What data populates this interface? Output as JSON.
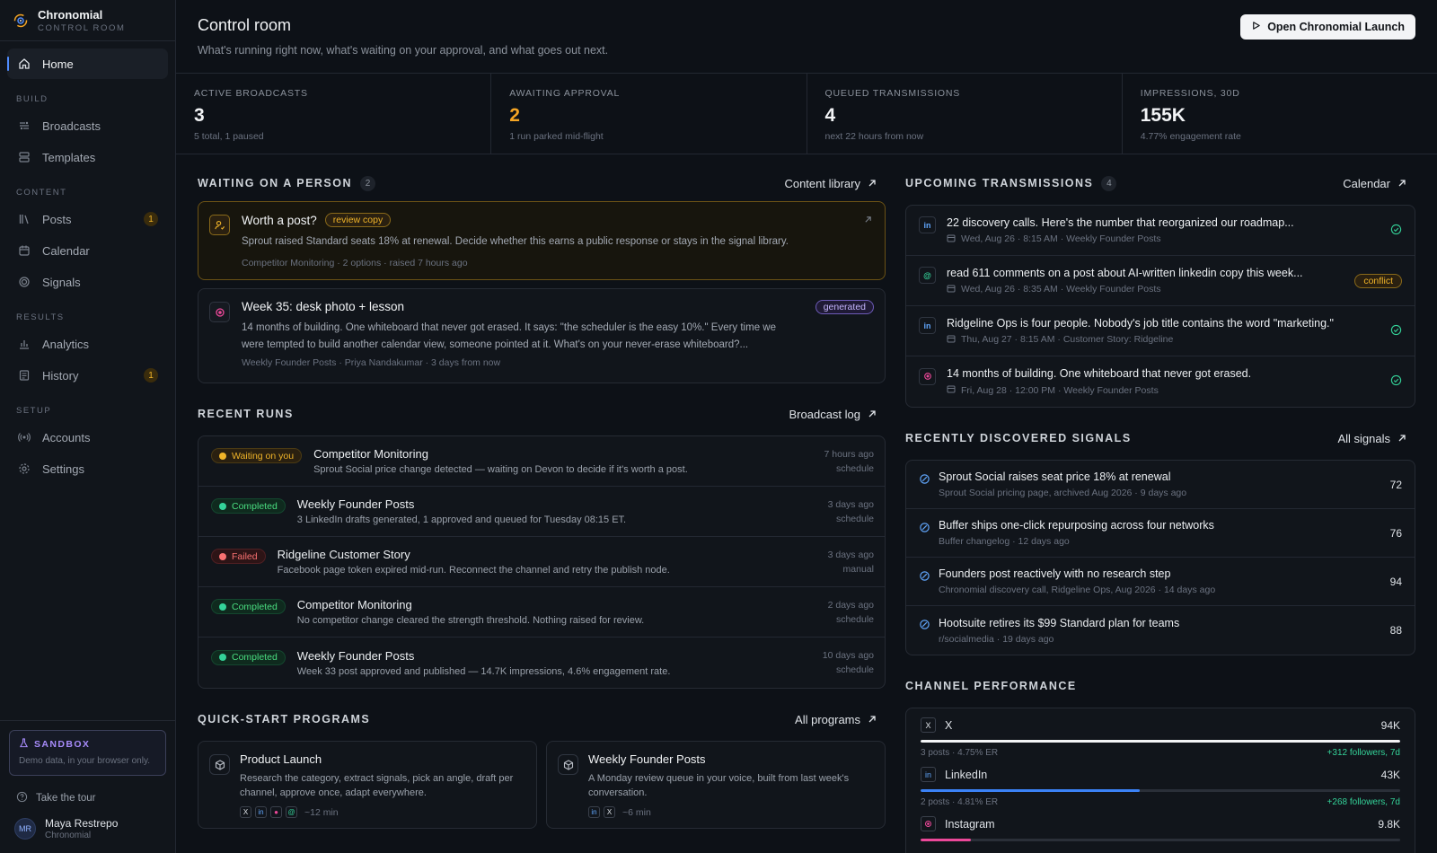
{
  "brand": {
    "name": "Chronomial",
    "sub": "CONTROL ROOM"
  },
  "nav": {
    "home": "Home",
    "sections": {
      "build": "BUILD",
      "content": "CONTENT",
      "results": "RESULTS",
      "setup": "SETUP"
    },
    "broadcasts": "Broadcasts",
    "templates": "Templates",
    "posts": "Posts",
    "posts_badge": "1",
    "calendar": "Calendar",
    "signals": "Signals",
    "analytics": "Analytics",
    "history": "History",
    "history_badge": "1",
    "accounts": "Accounts",
    "settings": "Settings"
  },
  "sandbox": {
    "title": "SANDBOX",
    "text": "Demo data, in your browser only."
  },
  "tour": "Take the tour",
  "user": {
    "initials": "MR",
    "name": "Maya Restrepo",
    "org": "Chronomial"
  },
  "header": {
    "title": "Control room",
    "subtitle": "What's running right now, what's waiting on your approval, and what goes out next.",
    "launch_button": "Open Chronomial Launch"
  },
  "stats": [
    {
      "label": "ACTIVE BROADCASTS",
      "value": "3",
      "note": "5 total, 1 paused"
    },
    {
      "label": "AWAITING APPROVAL",
      "value": "2",
      "note": "1 run parked mid-flight"
    },
    {
      "label": "QUEUED TRANSMISSIONS",
      "value": "4",
      "note": "next 22 hours from now"
    },
    {
      "label": "IMPRESSIONS, 30D",
      "value": "155K",
      "note": "4.77% engagement rate"
    }
  ],
  "waiting": {
    "title": "WAITING ON A PERSON",
    "count": "2",
    "link": "Content library",
    "items": [
      {
        "title": "Worth a post?",
        "tag": "review copy",
        "body": "Sprout raised Standard seats 18% at renewal. Decide whether this earns a public response or stays in the signal library.",
        "meta": "Competitor Monitoring · 2 options · raised 7 hours ago"
      },
      {
        "title": "Week 35: desk photo + lesson",
        "tag": "generated",
        "body": "14 months of building. One whiteboard that never got erased. It says: \"the scheduler is the easy 10%.\" Every time we were tempted to build another calendar view, someone pointed at it. What's on your never-erase whiteboard?...",
        "meta": "Weekly Founder Posts · Priya Nandakumar · 3 days from now"
      }
    ]
  },
  "runs": {
    "title": "RECENT RUNS",
    "link": "Broadcast log",
    "items": [
      {
        "status": "Waiting on you",
        "title": "Competitor Monitoring",
        "sub": "Sprout Social price change detected — waiting on Devon to decide if it's worth a post.",
        "time": "7 hours ago",
        "trigger": "schedule"
      },
      {
        "status": "Completed",
        "title": "Weekly Founder Posts",
        "sub": "3 LinkedIn drafts generated, 1 approved and queued for Tuesday 08:15 ET.",
        "time": "3 days ago",
        "trigger": "schedule"
      },
      {
        "status": "Failed",
        "title": "Ridgeline Customer Story",
        "sub": "Facebook page token expired mid-run. Reconnect the channel and retry the publish node.",
        "time": "3 days ago",
        "trigger": "manual"
      },
      {
        "status": "Completed",
        "title": "Competitor Monitoring",
        "sub": "No competitor change cleared the strength threshold. Nothing raised for review.",
        "time": "2 days ago",
        "trigger": "schedule"
      },
      {
        "status": "Completed",
        "title": "Weekly Founder Posts",
        "sub": "Week 33 post approved and published — 14.7K impressions, 4.6% engagement rate.",
        "time": "10 days ago",
        "trigger": "schedule"
      }
    ]
  },
  "programs": {
    "title": "QUICK-START PROGRAMS",
    "link": "All programs",
    "items": [
      {
        "title": "Product Launch",
        "body": "Research the category, extract signals, pick an angle, draft per channel, approve once, adapt everywhere.",
        "time": "~12 min"
      },
      {
        "title": "Weekly Founder Posts",
        "body": "A Monday review queue in your voice, built from last week's conversation.",
        "time": "~6 min"
      }
    ]
  },
  "upcoming": {
    "title": "UPCOMING TRANSMISSIONS",
    "count": "4",
    "link": "Calendar",
    "items": [
      {
        "channel": "in",
        "title": "22 discovery calls. Here's the number that reorganized our roadmap...",
        "meta": "Wed, Aug 26 · 8:15 AM  · Weekly Founder Posts"
      },
      {
        "channel": "@",
        "title": "read 611 comments on a post about AI-written linkedin copy this week...",
        "meta": "Wed, Aug 26 · 8:35 AM  · Weekly Founder Posts",
        "status": "conflict"
      },
      {
        "channel": "in",
        "title": "Ridgeline Ops is four people. Nobody's job title contains the word \"marketing.\"",
        "meta": "Thu, Aug 27 · 8:15 AM  · Customer Story: Ridgeline"
      },
      {
        "channel": "ig",
        "title": "14 months of building. One whiteboard that never got erased.",
        "meta": "Fri, Aug 28 · 12:00 PM  · Weekly Founder Posts"
      }
    ]
  },
  "signals": {
    "title": "RECENTLY DISCOVERED SIGNALS",
    "link": "All signals",
    "items": [
      {
        "title": "Sprout Social raises seat price 18% at renewal",
        "meta": "Sprout Social pricing page, archived Aug 2026 · 9 days ago",
        "score": "72"
      },
      {
        "title": "Buffer ships one-click repurposing across four networks",
        "meta": "Buffer changelog · 12 days ago",
        "score": "76"
      },
      {
        "title": "Founders post reactively with no research step",
        "meta": "Chronomial discovery call, Ridgeline Ops, Aug 2026 · 14 days ago",
        "score": "94"
      },
      {
        "title": "Hootsuite retires its $99 Standard plan for teams",
        "meta": "r/socialmedia · 19 days ago",
        "score": "88"
      }
    ]
  },
  "performance": {
    "title": "CHANNEL PERFORMANCE",
    "items": [
      {
        "icon": "X",
        "name": "X",
        "value": "94K",
        "share": 1.0,
        "color": "#f3f4f6",
        "meta": "3 posts · 4.75% ER",
        "growth": "+312 followers, 7d"
      },
      {
        "icon": "in",
        "name": "LinkedIn",
        "value": "43K",
        "share": 0.457,
        "color": "#3b82f6",
        "meta": "2 posts · 4.81% ER",
        "growth": "+268 followers, 7d"
      },
      {
        "icon": "ig",
        "name": "Instagram",
        "value": "9.8K",
        "share": 0.104,
        "color": "#ec4899",
        "meta": "",
        "growth": ""
      }
    ]
  },
  "colors": {
    "accent": "#4f8cff",
    "amber": "#f5a524",
    "success": "#34d399",
    "danger": "#f87171",
    "purple": "#a78bfa"
  }
}
